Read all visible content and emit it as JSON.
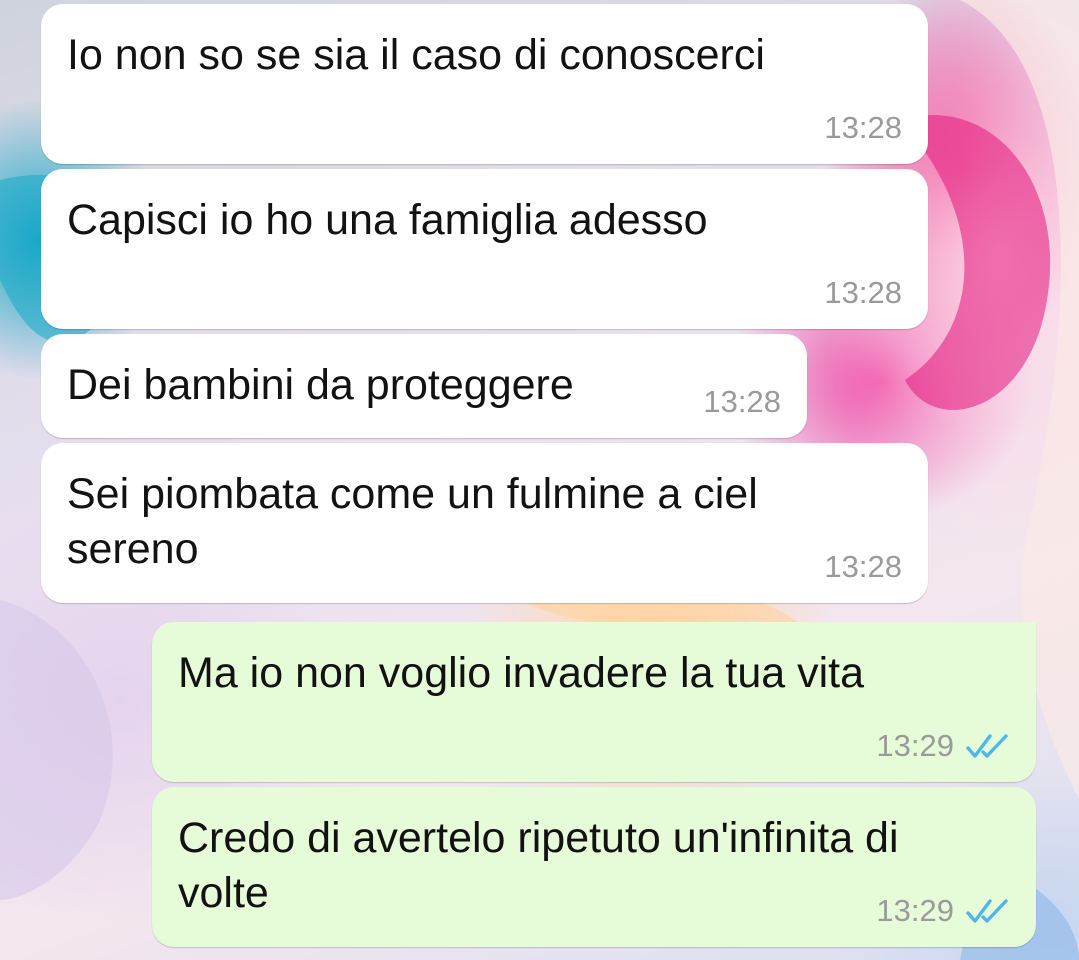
{
  "conversation": {
    "messages": [
      {
        "direction": "incoming",
        "text": "Io non so se sia il caso di conoscerci",
        "time": "13:28"
      },
      {
        "direction": "incoming",
        "text": "Capisci io ho una famiglia adesso",
        "time": "13:28"
      },
      {
        "direction": "incoming",
        "text": "Dei bambini da proteggere",
        "time": "13:28"
      },
      {
        "direction": "incoming",
        "text": "Sei piombata come un fulmine a ciel\nsereno",
        "time": "13:28"
      },
      {
        "direction": "outgoing",
        "text": "Ma io non voglio invadere la tua vita",
        "time": "13:29",
        "status": "read",
        "status_icon": "double-check-icon"
      },
      {
        "direction": "outgoing",
        "text": "Credo di avertelo ripetuto un'infinita di\nvolte",
        "time": "13:29",
        "status": "read",
        "status_icon": "double-check-icon"
      }
    ]
  },
  "colors": {
    "incoming_bubble": "#ffffff",
    "outgoing_bubble": "#e6fbd8",
    "read_ticks": "#4fb6ec",
    "time_text": "#9a9a9a"
  }
}
